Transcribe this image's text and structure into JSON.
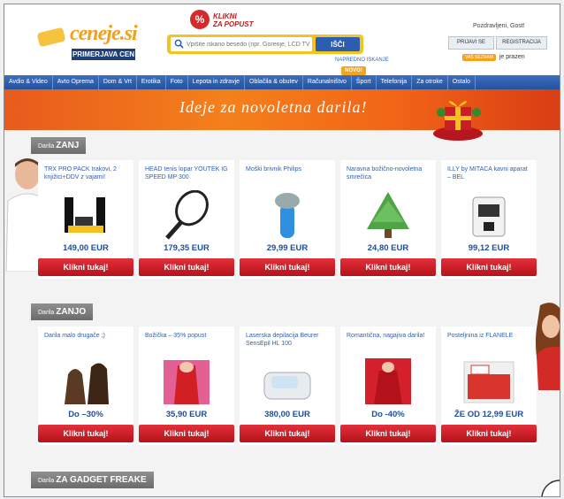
{
  "header": {
    "logo_text": "ceneje.si",
    "logo_sub": "PRIMERJAVA CEN",
    "promo_pct": "%",
    "promo_line1": "KLIKNI",
    "promo_line2": "ZA POPUST",
    "search_placeholder": "Vpišite iskano besedo (npr. Gorenje, LCD TV)",
    "search_button": "IŠČI",
    "advanced_search": "NAPREDNO ISKANJE",
    "novo": "NOVO!",
    "greeting": "Pozdravljeni, Gost!",
    "login": "PRIJAVI SE",
    "register": "REGISTRACIJA",
    "cart_badge": "VAŠ SEZNAM",
    "cart_status": "je prazen"
  },
  "nav": [
    "Avdio & Video",
    "Avto Oprema",
    "Dom & Vrt",
    "Erotika",
    "Foto",
    "Lepota in zdravje",
    "Oblačila & obutev",
    "Računalništvo",
    "Šport",
    "Telefonija",
    "Za otroke",
    "Ostalo"
  ],
  "banner": "Ideje za novoletna darila!",
  "sections": [
    {
      "prefix": "Darila",
      "title": "ZANJ",
      "items": [
        {
          "title": "TRX PRO PACK trakovi, 2 knjižici+DDV z vajami!",
          "price": "149,00 EUR",
          "button": "Klikni tukaj!",
          "icon": "trx-straps-image"
        },
        {
          "title": "HEAD tenis lopar YOUTEK IG SPEED MP 300",
          "price": "179,35 EUR",
          "button": "Klikni tukaj!",
          "icon": "tennis-racket-image"
        },
        {
          "title": "Moški brivnik Philips",
          "price": "29,99 EUR",
          "button": "Klikni tukaj!",
          "icon": "shaver-image"
        },
        {
          "title": "Naravna božično-novoletna smrečica",
          "price": "24,80 EUR",
          "button": "Klikni tukaj!",
          "icon": "christmas-tree-image"
        },
        {
          "title": "ILLY by MITACA kavni aparat – BEL",
          "price": "99,12 EUR",
          "button": "Klikni tukaj!",
          "icon": "coffee-machine-image"
        }
      ]
    },
    {
      "prefix": "Darila",
      "title": "ZANJO",
      "items": [
        {
          "title": "Darila malo drugače ;)",
          "price": "Do –30%",
          "button": "Klikni tukaj!",
          "icon": "chocolate-image"
        },
        {
          "title": "Božička – 35% popust",
          "price": "35,90 EUR",
          "button": "Klikni tukaj!",
          "icon": "santa-costume-image"
        },
        {
          "title": "Laserska depilacija Beurer SensEpil HL 100",
          "price": "380,00 EUR",
          "button": "Klikni tukaj!",
          "icon": "epilator-image"
        },
        {
          "title": "Romantična, nagajiva darila!",
          "price": "Do -40%",
          "button": "Klikni tukaj!",
          "icon": "santa-dress-image"
        },
        {
          "title": "Posteljnina iz FLANELE",
          "price": "ŽE OD 12,99 EUR",
          "button": "Klikni tukaj!",
          "icon": "bedding-image"
        }
      ]
    },
    {
      "prefix": "Darila",
      "title": "ZA GADGET FREAKE",
      "items": []
    }
  ],
  "colors": {
    "brand_blue": "#24529c",
    "button_red": "#c91d27",
    "price_blue": "#1f4ea1",
    "banner_orange": "#f4801b"
  }
}
